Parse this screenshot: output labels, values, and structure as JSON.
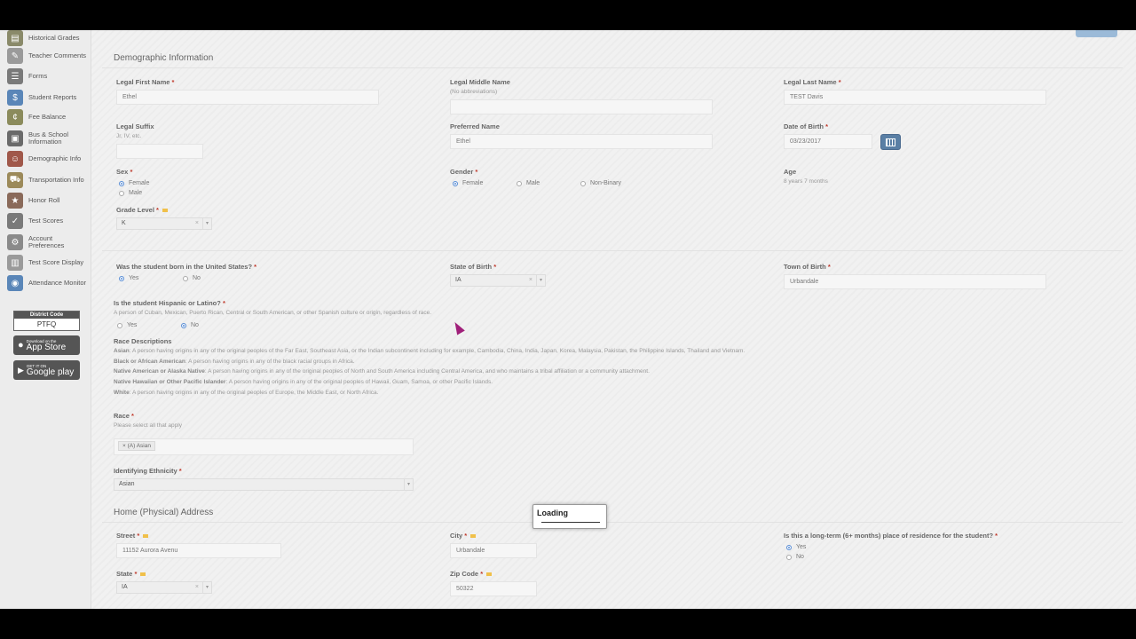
{
  "sidebar": {
    "items": [
      {
        "label": "Historical Grades",
        "icon": "book-icon"
      },
      {
        "label": "Teacher Comments",
        "icon": "comment-icon"
      },
      {
        "label": "Forms",
        "icon": "form-icon"
      },
      {
        "label": "Student Reports",
        "icon": "report-icon"
      },
      {
        "label": "Fee Balance",
        "icon": "money-icon"
      },
      {
        "label": "Bus & School Information",
        "icon": "bus-icon"
      },
      {
        "label": "Demographic Info",
        "icon": "person-icon"
      },
      {
        "label": "Transportation Info",
        "icon": "transport-icon"
      },
      {
        "label": "Honor Roll",
        "icon": "medal-icon"
      },
      {
        "label": "Test Scores",
        "icon": "test-icon"
      },
      {
        "label": "Account Preferences",
        "icon": "gear-icon"
      },
      {
        "label": "Test Score Display",
        "icon": "chart-icon"
      },
      {
        "label": "Attendance Monitor",
        "icon": "attendance-icon"
      }
    ],
    "district_label": "District Code",
    "district_code": "PTFQ",
    "appstore_small": "Download on the",
    "appstore_big": "App Store",
    "googleplay_small": "GET IT ON",
    "googleplay_big": "Google play"
  },
  "demographic": {
    "title": "Demographic Information",
    "first_name_label": "Legal First Name",
    "first_name": "Ethel",
    "middle_name_label": "Legal Middle Name",
    "middle_name_hint": "(No abbreviations)",
    "last_name_label": "Legal Last Name",
    "last_name": "TEST Davis",
    "suffix_label": "Legal Suffix",
    "suffix_hint": "Jr, IV, etc.",
    "preferred_label": "Preferred Name",
    "preferred": "Ethel",
    "dob_label": "Date of Birth",
    "dob": "03/23/2017",
    "sex_label": "Sex",
    "sex_female": "Female",
    "sex_male": "Male",
    "gender_label": "Gender",
    "gender_female": "Female",
    "gender_male": "Male",
    "gender_nonbinary": "Non-Binary",
    "age_label": "Age",
    "age": "8 years 7 months",
    "grade_label": "Grade Level",
    "grade": "K",
    "born_us_label": "Was the student born in the United States?",
    "yes": "Yes",
    "no": "No",
    "state_birth_label": "State of Birth",
    "state_birth": "IA",
    "town_birth_label": "Town of Birth",
    "town_birth": "Urbandale",
    "hispanic_label": "Is the student Hispanic or Latino?",
    "hispanic_hint": "A person of Cuban, Mexican, Puerto Rican, Central or South American, or other Spanish culture or origin, regardless of race.",
    "race_desc_title": "Race Descriptions",
    "race_descs": [
      {
        "name": "Asian",
        "text": ": A person having origins in any of the original peoples of the Far East, Southeast Asia, or the Indian subcontinent including for example, Cambodia, China, India, Japan, Korea, Malaysia, Pakistan, the Philippine Islands, Thailand and Vietnam."
      },
      {
        "name": "Black or African American",
        "text": ": A person having origins in any of the black racial groups in Africa."
      },
      {
        "name": "Native American or Alaska Native",
        "text": ": A person having origins in any of the original peoples of North and South America including Central America, and who maintains a tribal affiliation or a community attachment."
      },
      {
        "name": "Native Hawaiian or Other Pacific Islander",
        "text": ": A person having origins in any of the original peoples of Hawaii, Guam, Samoa, or other Pacific Islands."
      },
      {
        "name": "White",
        "text": ": A person having origins in any of the original peoples of Europe, the Middle East, or North Africa."
      }
    ],
    "race_label": "Race",
    "race_hint": "Please select all that apply",
    "race_tag": "(A) Asian",
    "ethnicity_label": "Identifying Ethnicity",
    "ethnicity": "Asian"
  },
  "address": {
    "title": "Home (Physical) Address",
    "street_label": "Street",
    "street": "11152 Aurora Avenu",
    "city_label": "City",
    "city": "Urbandale",
    "longterm_label": "Is this a long-term (6+ months) place of residence for the student?",
    "state_label": "State",
    "state": "IA",
    "zip_label": "Zip Code",
    "zip": "50322"
  },
  "loading": "Loading"
}
